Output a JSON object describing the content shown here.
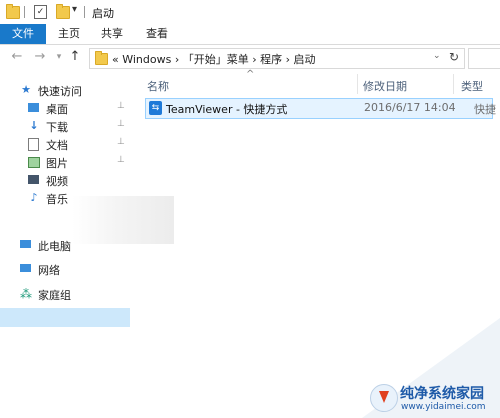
{
  "titlebar": {
    "title": "启动",
    "dropdown_glyph": "▾"
  },
  "ribbon": {
    "tabs": [
      "文件",
      "主页",
      "共享",
      "查看"
    ]
  },
  "navigation": {
    "back_glyph": "←",
    "forward_glyph": "→",
    "recent_glyph": "▾",
    "up_glyph": "↑"
  },
  "address": {
    "path_text": "«  Windows  ›  「开始」菜单  ›  程序  ›  启动",
    "dropdown_glyph": "⌄",
    "refresh_glyph": "↻"
  },
  "nav_pane": {
    "quick_access": {
      "label": "快速访问",
      "icon": "star-icon"
    },
    "items": [
      {
        "label": "桌面",
        "icon": "desktop-icon",
        "pinned": true
      },
      {
        "label": "下载",
        "icon": "download-icon",
        "pinned": true
      },
      {
        "label": "文档",
        "icon": "document-icon",
        "pinned": true
      },
      {
        "label": "图片",
        "icon": "picture-icon",
        "pinned": true
      },
      {
        "label": "视频",
        "icon": "video-icon",
        "pinned": false
      },
      {
        "label": "音乐",
        "icon": "music-icon",
        "pinned": false
      }
    ],
    "this_pc": {
      "label": "此电脑",
      "icon": "computer-icon"
    },
    "network": {
      "label": "网络",
      "icon": "network-icon"
    },
    "homegroup": {
      "label": "家庭组",
      "icon": "homegroup-icon"
    },
    "pin_glyph": "⊥"
  },
  "columns": {
    "name": "名称",
    "date": "修改日期",
    "type": "类型",
    "sort_glyph": "^"
  },
  "files": [
    {
      "name": "TeamViewer - 快捷方式",
      "date": "2016/6/17 14:04",
      "type": "快捷",
      "icon": "teamviewer-icon"
    }
  ],
  "watermark": {
    "title": "纯净系统家园",
    "url": "www.yidaimei.com"
  },
  "colors": {
    "file_tab": "#1979ca",
    "selection": "#e5f3ff",
    "selection_border": "#99d1ff",
    "nav_selected": "#cde8fb"
  }
}
